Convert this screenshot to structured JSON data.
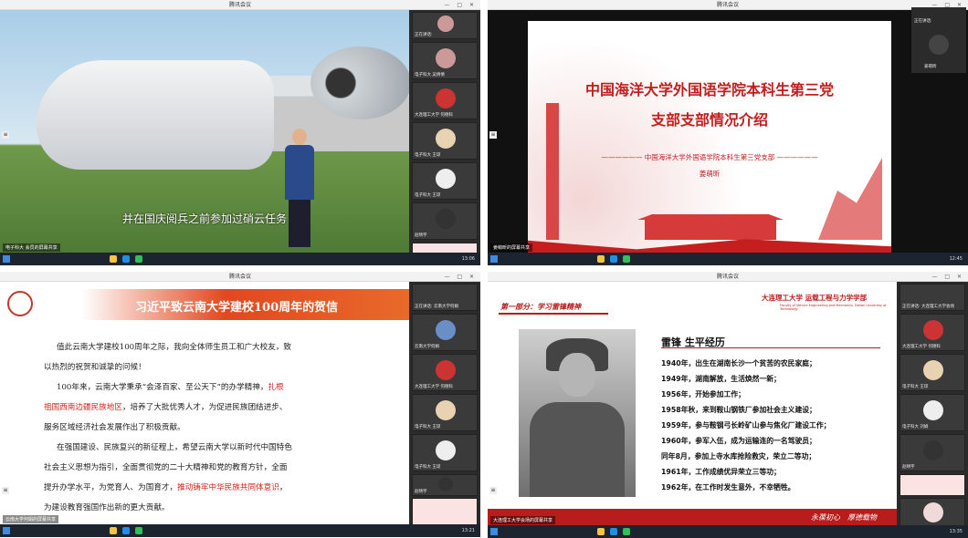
{
  "window_title": "腾讯会议",
  "window_controls": "— □ ✕",
  "q1": {
    "share_label": "电子科大 会员的屏幕共享",
    "subtitle": "并在国庆阅兵之前参加过硝云任务",
    "clock": "13:06",
    "participants": [
      "正在讲话:",
      "电子科大 吴倩倩",
      "大连理工大学 何德科",
      "电子科大 王琼",
      "电子科大 王琼",
      "赵晴宇",
      ""
    ]
  },
  "q2": {
    "share_label": "姜萌昕的屏幕共享",
    "title1": "中国海洋大学外国语学院本科生第三党",
    "title2": "支部支部情况介绍",
    "line": "—————— 中国海洋大学外国语学院本科生第三党支部 ——————",
    "name": "姜萌昕",
    "clock": "12:45",
    "participants": [
      "正在讲话:",
      "姜萌昕"
    ]
  },
  "q3": {
    "share_label": "云南大学何娟的屏幕共享",
    "title": "习近平致云南大学建校100周年的贺信",
    "p1a": "值此云南大学建校100周年之际，我向全体师生员工和广大校友，致",
    "p1b": "以热烈的祝贺和诚挚的问候！",
    "p2a": "100年来，云南大学秉承“会泽百家、至公天下”的办学精神，",
    "p2a_red": "扎根",
    "p2b_red": "祖国西南边疆民族地区",
    "p2b": "，培养了大批优秀人才，为促进民族团结进步、",
    "p2c": "服务区域经济社会发展作出了积极贡献。",
    "p3a": "在强国建设、民族复兴的新征程上，希望云南大学以新时代中国特色",
    "p3b": "社会主义思想为指引，全面贯彻党的二十大精神和党的教育方针，全面",
    "p3c": "提升办学水平，为党育人、为国育才，",
    "p3c_red": "推动铸牢中华民族共同体意识",
    "p3c_end": "，",
    "p3d": "为建设教育强国作出新的更大贡献。",
    "clock": "13:21",
    "participants": [
      "正在讲话: 云南大学何娟",
      "云南大学何娟",
      "大连理工大学 何德科",
      "电子科大 王琼",
      "电子科大 王琼",
      "赵晴宇",
      "",
      "电子科大 吴倩倩"
    ]
  },
  "q4": {
    "share_label": "大连理工大学会场的屏幕共享",
    "section": "第一部分：学习雷锋精神",
    "university": "大连理工大学 运载工程与力学学部",
    "university_sub": "Faculty of Vehicle Engineering and Mechanics, Dalian University of Technology",
    "heading": "雷锋 生平经历",
    "items": [
      "1940年，出生在湖南长沙一个贫苦的农民家庭；",
      "1949年，湖南解放，生活焕然一新；",
      "1956年，开始参加工作；",
      "1958年秋，来到鞍山钢铁厂参加社会主义建设；",
      "1959年，参与鞍钢弓长岭矿山参与焦化厂建设工作；",
      "1960年，参军入伍，成为运输连的一名驾驶员；",
      "同年8月，参加上寺水库抢险救灾，荣立二等功；",
      "1961年，工作成绩优异荣立三等功；",
      "1962年，在工作时发生意外，不幸牺牲。"
    ],
    "motto": "永葆初心　厚德载物",
    "clock": "13:35",
    "participants": [
      "正在讲话: 大连理工大学会场",
      "大连理工大学 何德科",
      "电子科大 王琼",
      "电子科大 刘娟",
      "赵晴宇",
      "",
      "电子科大 吴倩倩"
    ]
  }
}
